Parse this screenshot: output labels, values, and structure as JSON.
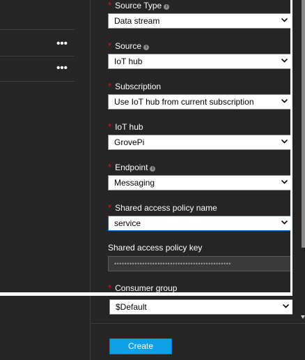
{
  "left_panel": {
    "more_label": "•••"
  },
  "form": {
    "source_type": {
      "required": "*",
      "label": "Source Type",
      "info": "i",
      "value": "Data stream"
    },
    "source": {
      "required": "*",
      "label": "Source",
      "info": "i",
      "value": "IoT hub"
    },
    "subscription": {
      "required": "*",
      "label": "Subscription",
      "value": "Use IoT hub from current subscription"
    },
    "iot_hub": {
      "required": "*",
      "label": "IoT hub",
      "value": "GrovePi"
    },
    "endpoint": {
      "required": "*",
      "label": "Endpoint",
      "info": "i",
      "value": "Messaging"
    },
    "policy_name": {
      "required": "*",
      "label": "Shared access policy name",
      "value": "service"
    },
    "policy_key": {
      "label": "Shared access policy key",
      "value": "••••••••••••••••••••••••••••••••••••••••••••••"
    },
    "consumer_group": {
      "required": "*",
      "label": "Consumer group",
      "value": "$Default"
    }
  },
  "footer": {
    "create_label": "Create"
  },
  "colors": {
    "background": "#252526",
    "accent": "#0fa0e8",
    "required": "#e81123",
    "focus_border": "#0078d7"
  }
}
